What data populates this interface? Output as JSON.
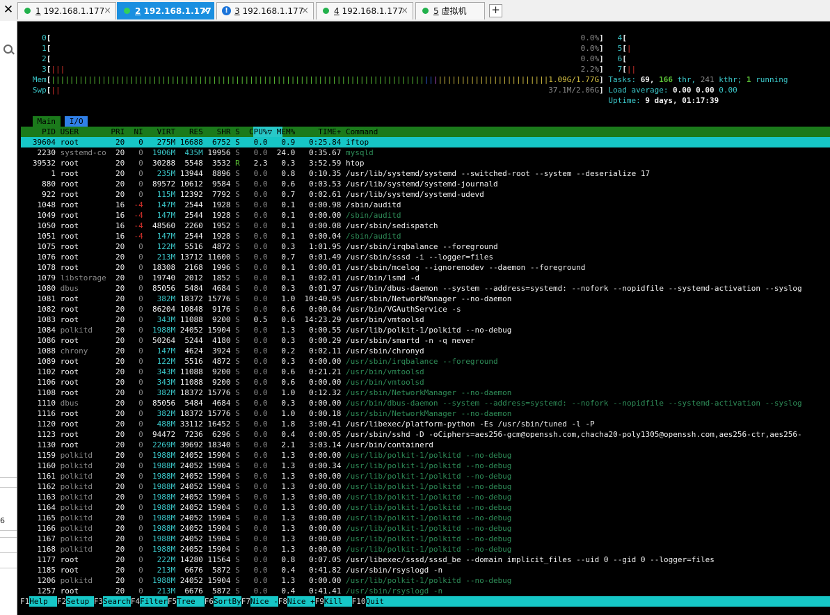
{
  "window": {
    "close_symbol": "✕",
    "tabs": [
      {
        "num": "1",
        "label": "192.168.1.177",
        "status": "connected",
        "active": false
      },
      {
        "num": "2",
        "label": "192.168.1.177",
        "status": "connected",
        "active": true
      },
      {
        "num": "3",
        "label": "192.168.1.177",
        "status": "warning",
        "active": false
      },
      {
        "num": "4",
        "label": "192.168.1.177",
        "status": "connected",
        "active": false
      },
      {
        "num": "5",
        "label": "虚拟机",
        "status": "connected",
        "active": false
      }
    ],
    "add_tab": "+",
    "left_digit": "6",
    "warn_symbol": "!",
    "tab_close": "×"
  },
  "meters": {
    "cpus": [
      {
        "id": "0",
        "bar": "",
        "pct": "0.0%"
      },
      {
        "id": "1",
        "bar": "",
        "pct": "0.0%"
      },
      {
        "id": "2",
        "bar": "",
        "pct": "0.0%"
      },
      {
        "id": "3",
        "bar": "|||",
        "pct": "2.2%"
      },
      {
        "id": "4",
        "bar": "",
        "pct": ""
      },
      {
        "id": "5",
        "bar": "|",
        "pct": ""
      },
      {
        "id": "6",
        "bar": "",
        "pct": ""
      },
      {
        "id": "7",
        "bar": "||",
        "pct": ""
      }
    ],
    "mem_label": "Mem",
    "mem_value": "1.09G/1.77G",
    "swp_label": "Swp",
    "swp_value": "37.1M/2.06G",
    "tasks_label": "Tasks:",
    "tasks": "69",
    "thr": "166",
    "thr_label": "thr,",
    "kthr": "241",
    "kthr_label": "kthr;",
    "running": "1",
    "running_label": "running",
    "load_label": "Load average:",
    "load1": "0.00",
    "load5": "0.00",
    "load15": "0.00",
    "uptime_label": "Uptime:",
    "uptime": "9 days, 01:17:39"
  },
  "screen_tabs": {
    "main": "Main",
    "io": "I/O"
  },
  "columns": {
    "pid": "PID",
    "user": "USER",
    "pri": "PRI",
    "ni": "NI",
    "virt": "VIRT",
    "res": "RES",
    "shr": "SHR",
    "s": "S",
    "cpu": "CPU%",
    "sort_indicator": "▽",
    "mem": "MEM%",
    "time": "TIME+",
    "command": "Command"
  },
  "processes": [
    {
      "pid": "39604",
      "user": "root",
      "pri": "20",
      "ni": "0",
      "virt": "275M",
      "res": "16688",
      "shr": "6752",
      "s": "S",
      "cpu": "0.0",
      "mem": "0.9",
      "time": "0:25.84",
      "cmd": "iftop",
      "thread": false,
      "selected": true
    },
    {
      "pid": "2230",
      "user": "systemd-co",
      "pri": "20",
      "ni": "0",
      "virt": "1906M",
      "res": "435M",
      "shr": "19956",
      "s": "S",
      "cpu": "0.0",
      "mem": "24.0",
      "time": "0:35.67",
      "cmd": "mysqld",
      "thread": true
    },
    {
      "pid": "39532",
      "user": "root",
      "pri": "20",
      "ni": "0",
      "virt": "30288",
      "res": "5548",
      "shr": "3532",
      "s": "R",
      "cpu": "2.3",
      "mem": "0.3",
      "time": "3:52.59",
      "cmd": "htop",
      "thread": false
    },
    {
      "pid": "1",
      "user": "root",
      "pri": "20",
      "ni": "0",
      "virt": "235M",
      "res": "13944",
      "shr": "8896",
      "s": "S",
      "cpu": "0.0",
      "mem": "0.8",
      "time": "0:10.35",
      "cmd": "/usr/lib/systemd/systemd --switched-root --system --deserialize 17",
      "thread": false
    },
    {
      "pid": "880",
      "user": "root",
      "pri": "20",
      "ni": "0",
      "virt": "89572",
      "res": "10612",
      "shr": "9584",
      "s": "S",
      "cpu": "0.0",
      "mem": "0.6",
      "time": "0:03.53",
      "cmd": "/usr/lib/systemd/systemd-journald",
      "thread": false
    },
    {
      "pid": "922",
      "user": "root",
      "pri": "20",
      "ni": "0",
      "virt": "115M",
      "res": "12392",
      "shr": "7792",
      "s": "S",
      "cpu": "0.0",
      "mem": "0.7",
      "time": "0:02.61",
      "cmd": "/usr/lib/systemd/systemd-udevd",
      "thread": false
    },
    {
      "pid": "1048",
      "user": "root",
      "pri": "16",
      "ni": "-4",
      "virt": "147M",
      "res": "2544",
      "shr": "1928",
      "s": "S",
      "cpu": "0.0",
      "mem": "0.1",
      "time": "0:00.98",
      "cmd": "/sbin/auditd",
      "thread": false
    },
    {
      "pid": "1049",
      "user": "root",
      "pri": "16",
      "ni": "-4",
      "virt": "147M",
      "res": "2544",
      "shr": "1928",
      "s": "S",
      "cpu": "0.0",
      "mem": "0.1",
      "time": "0:00.00",
      "cmd": "/sbin/auditd",
      "thread": true
    },
    {
      "pid": "1050",
      "user": "root",
      "pri": "16",
      "ni": "-4",
      "virt": "48560",
      "res": "2260",
      "shr": "1952",
      "s": "S",
      "cpu": "0.0",
      "mem": "0.1",
      "time": "0:00.08",
      "cmd": "/usr/sbin/sedispatch",
      "thread": false
    },
    {
      "pid": "1051",
      "user": "root",
      "pri": "16",
      "ni": "-4",
      "virt": "147M",
      "res": "2544",
      "shr": "1928",
      "s": "S",
      "cpu": "0.0",
      "mem": "0.1",
      "time": "0:00.04",
      "cmd": "/sbin/auditd",
      "thread": true
    },
    {
      "pid": "1075",
      "user": "root",
      "pri": "20",
      "ni": "0",
      "virt": "122M",
      "res": "5516",
      "shr": "4872",
      "s": "S",
      "cpu": "0.0",
      "mem": "0.3",
      "time": "1:01.95",
      "cmd": "/usr/sbin/irqbalance --foreground",
      "thread": false
    },
    {
      "pid": "1076",
      "user": "root",
      "pri": "20",
      "ni": "0",
      "virt": "213M",
      "res": "13712",
      "shr": "11600",
      "s": "S",
      "cpu": "0.0",
      "mem": "0.7",
      "time": "0:01.49",
      "cmd": "/usr/sbin/sssd -i --logger=files",
      "thread": false
    },
    {
      "pid": "1078",
      "user": "root",
      "pri": "20",
      "ni": "0",
      "virt": "18308",
      "res": "2168",
      "shr": "1996",
      "s": "S",
      "cpu": "0.0",
      "mem": "0.1",
      "time": "0:00.01",
      "cmd": "/usr/sbin/mcelog --ignorenodev --daemon --foreground",
      "thread": false
    },
    {
      "pid": "1079",
      "user": "libstorage",
      "pri": "20",
      "ni": "0",
      "virt": "19740",
      "res": "2012",
      "shr": "1852",
      "s": "S",
      "cpu": "0.0",
      "mem": "0.1",
      "time": "0:02.01",
      "cmd": "/usr/bin/lsmd -d",
      "thread": false
    },
    {
      "pid": "1080",
      "user": "dbus",
      "pri": "20",
      "ni": "0",
      "virt": "85056",
      "res": "5484",
      "shr": "4684",
      "s": "S",
      "cpu": "0.0",
      "mem": "0.3",
      "time": "0:01.97",
      "cmd": "/usr/bin/dbus-daemon --system --address=systemd: --nofork --nopidfile --systemd-activation --syslog",
      "thread": false
    },
    {
      "pid": "1081",
      "user": "root",
      "pri": "20",
      "ni": "0",
      "virt": "382M",
      "res": "18372",
      "shr": "15776",
      "s": "S",
      "cpu": "0.0",
      "mem": "1.0",
      "time": "10:40.95",
      "cmd": "/usr/sbin/NetworkManager --no-daemon",
      "thread": false
    },
    {
      "pid": "1082",
      "user": "root",
      "pri": "20",
      "ni": "0",
      "virt": "86204",
      "res": "10848",
      "shr": "9176",
      "s": "S",
      "cpu": "0.0",
      "mem": "0.6",
      "time": "0:00.04",
      "cmd": "/usr/bin/VGAuthService -s",
      "thread": false
    },
    {
      "pid": "1083",
      "user": "root",
      "pri": "20",
      "ni": "0",
      "virt": "343M",
      "res": "11088",
      "shr": "9200",
      "s": "S",
      "cpu": "0.5",
      "mem": "0.6",
      "time": "14:23.29",
      "cmd": "/usr/bin/vmtoolsd",
      "thread": false
    },
    {
      "pid": "1084",
      "user": "polkitd",
      "pri": "20",
      "ni": "0",
      "virt": "1988M",
      "res": "24052",
      "shr": "15904",
      "s": "S",
      "cpu": "0.0",
      "mem": "1.3",
      "time": "0:00.55",
      "cmd": "/usr/lib/polkit-1/polkitd --no-debug",
      "thread": false
    },
    {
      "pid": "1086",
      "user": "root",
      "pri": "20",
      "ni": "0",
      "virt": "50264",
      "res": "5244",
      "shr": "4180",
      "s": "S",
      "cpu": "0.0",
      "mem": "0.3",
      "time": "0:00.29",
      "cmd": "/usr/sbin/smartd -n -q never",
      "thread": false
    },
    {
      "pid": "1088",
      "user": "chrony",
      "pri": "20",
      "ni": "0",
      "virt": "147M",
      "res": "4624",
      "shr": "3924",
      "s": "S",
      "cpu": "0.0",
      "mem": "0.2",
      "time": "0:02.11",
      "cmd": "/usr/sbin/chronyd",
      "thread": false
    },
    {
      "pid": "1089",
      "user": "root",
      "pri": "20",
      "ni": "0",
      "virt": "122M",
      "res": "5516",
      "shr": "4872",
      "s": "S",
      "cpu": "0.0",
      "mem": "0.3",
      "time": "0:00.00",
      "cmd": "/usr/sbin/irqbalance --foreground",
      "thread": true
    },
    {
      "pid": "1102",
      "user": "root",
      "pri": "20",
      "ni": "0",
      "virt": "343M",
      "res": "11088",
      "shr": "9200",
      "s": "S",
      "cpu": "0.0",
      "mem": "0.6",
      "time": "0:21.21",
      "cmd": "/usr/bin/vmtoolsd",
      "thread": true
    },
    {
      "pid": "1106",
      "user": "root",
      "pri": "20",
      "ni": "0",
      "virt": "343M",
      "res": "11088",
      "shr": "9200",
      "s": "S",
      "cpu": "0.0",
      "mem": "0.6",
      "time": "0:00.00",
      "cmd": "/usr/bin/vmtoolsd",
      "thread": true
    },
    {
      "pid": "1108",
      "user": "root",
      "pri": "20",
      "ni": "0",
      "virt": "382M",
      "res": "18372",
      "shr": "15776",
      "s": "S",
      "cpu": "0.0",
      "mem": "1.0",
      "time": "0:12.32",
      "cmd": "/usr/sbin/NetworkManager --no-daemon",
      "thread": true
    },
    {
      "pid": "1110",
      "user": "dbus",
      "pri": "20",
      "ni": "0",
      "virt": "85056",
      "res": "5484",
      "shr": "4684",
      "s": "S",
      "cpu": "0.0",
      "mem": "0.3",
      "time": "0:00.00",
      "cmd": "/usr/bin/dbus-daemon --system --address=systemd: --nofork --nopidfile --systemd-activation --syslog",
      "thread": true
    },
    {
      "pid": "1116",
      "user": "root",
      "pri": "20",
      "ni": "0",
      "virt": "382M",
      "res": "18372",
      "shr": "15776",
      "s": "S",
      "cpu": "0.0",
      "mem": "1.0",
      "time": "0:00.18",
      "cmd": "/usr/sbin/NetworkManager --no-daemon",
      "thread": true
    },
    {
      "pid": "1120",
      "user": "root",
      "pri": "20",
      "ni": "0",
      "virt": "488M",
      "res": "33112",
      "shr": "16452",
      "s": "S",
      "cpu": "0.0",
      "mem": "1.8",
      "time": "3:00.41",
      "cmd": "/usr/libexec/platform-python -Es /usr/sbin/tuned -l -P",
      "thread": false
    },
    {
      "pid": "1123",
      "user": "root",
      "pri": "20",
      "ni": "0",
      "virt": "94472",
      "res": "7236",
      "shr": "6296",
      "s": "S",
      "cpu": "0.0",
      "mem": "0.4",
      "time": "0:00.05",
      "cmd": "/usr/sbin/sshd -D -oCiphers=aes256-gcm@openssh.com,chacha20-poly1305@openssh.com,aes256-ctr,aes256-",
      "thread": false
    },
    {
      "pid": "1130",
      "user": "root",
      "pri": "20",
      "ni": "0",
      "virt": "2269M",
      "res": "39692",
      "shr": "18340",
      "s": "S",
      "cpu": "0.0",
      "mem": "2.1",
      "time": "3:03.14",
      "cmd": "/usr/bin/containerd",
      "thread": false
    },
    {
      "pid": "1159",
      "user": "polkitd",
      "pri": "20",
      "ni": "0",
      "virt": "1988M",
      "res": "24052",
      "shr": "15904",
      "s": "S",
      "cpu": "0.0",
      "mem": "1.3",
      "time": "0:00.00",
      "cmd": "/usr/lib/polkit-1/polkitd --no-debug",
      "thread": true
    },
    {
      "pid": "1160",
      "user": "polkitd",
      "pri": "20",
      "ni": "0",
      "virt": "1988M",
      "res": "24052",
      "shr": "15904",
      "s": "S",
      "cpu": "0.0",
      "mem": "1.3",
      "time": "0:00.34",
      "cmd": "/usr/lib/polkit-1/polkitd --no-debug",
      "thread": true
    },
    {
      "pid": "1161",
      "user": "polkitd",
      "pri": "20",
      "ni": "0",
      "virt": "1988M",
      "res": "24052",
      "shr": "15904",
      "s": "S",
      "cpu": "0.0",
      "mem": "1.3",
      "time": "0:00.00",
      "cmd": "/usr/lib/polkit-1/polkitd --no-debug",
      "thread": true
    },
    {
      "pid": "1162",
      "user": "polkitd",
      "pri": "20",
      "ni": "0",
      "virt": "1988M",
      "res": "24052",
      "shr": "15904",
      "s": "S",
      "cpu": "0.0",
      "mem": "1.3",
      "time": "0:00.00",
      "cmd": "/usr/lib/polkit-1/polkitd --no-debug",
      "thread": true
    },
    {
      "pid": "1163",
      "user": "polkitd",
      "pri": "20",
      "ni": "0",
      "virt": "1988M",
      "res": "24052",
      "shr": "15904",
      "s": "S",
      "cpu": "0.0",
      "mem": "1.3",
      "time": "0:00.00",
      "cmd": "/usr/lib/polkit-1/polkitd --no-debug",
      "thread": true
    },
    {
      "pid": "1164",
      "user": "polkitd",
      "pri": "20",
      "ni": "0",
      "virt": "1988M",
      "res": "24052",
      "shr": "15904",
      "s": "S",
      "cpu": "0.0",
      "mem": "1.3",
      "time": "0:00.00",
      "cmd": "/usr/lib/polkit-1/polkitd --no-debug",
      "thread": true
    },
    {
      "pid": "1165",
      "user": "polkitd",
      "pri": "20",
      "ni": "0",
      "virt": "1988M",
      "res": "24052",
      "shr": "15904",
      "s": "S",
      "cpu": "0.0",
      "mem": "1.3",
      "time": "0:00.00",
      "cmd": "/usr/lib/polkit-1/polkitd --no-debug",
      "thread": true
    },
    {
      "pid": "1166",
      "user": "polkitd",
      "pri": "20",
      "ni": "0",
      "virt": "1988M",
      "res": "24052",
      "shr": "15904",
      "s": "S",
      "cpu": "0.0",
      "mem": "1.3",
      "time": "0:00.00",
      "cmd": "/usr/lib/polkit-1/polkitd --no-debug",
      "thread": true
    },
    {
      "pid": "1167",
      "user": "polkitd",
      "pri": "20",
      "ni": "0",
      "virt": "1988M",
      "res": "24052",
      "shr": "15904",
      "s": "S",
      "cpu": "0.0",
      "mem": "1.3",
      "time": "0:00.00",
      "cmd": "/usr/lib/polkit-1/polkitd --no-debug",
      "thread": true
    },
    {
      "pid": "1168",
      "user": "polkitd",
      "pri": "20",
      "ni": "0",
      "virt": "1988M",
      "res": "24052",
      "shr": "15904",
      "s": "S",
      "cpu": "0.0",
      "mem": "1.3",
      "time": "0:00.00",
      "cmd": "/usr/lib/polkit-1/polkitd --no-debug",
      "thread": true
    },
    {
      "pid": "1177",
      "user": "root",
      "pri": "20",
      "ni": "0",
      "virt": "222M",
      "res": "14280",
      "shr": "11564",
      "s": "S",
      "cpu": "0.0",
      "mem": "0.8",
      "time": "0:07.05",
      "cmd": "/usr/libexec/sssd/sssd_be --domain implicit_files --uid 0 --gid 0 --logger=files",
      "thread": false
    },
    {
      "pid": "1185",
      "user": "root",
      "pri": "20",
      "ni": "0",
      "virt": "213M",
      "res": "6676",
      "shr": "5872",
      "s": "S",
      "cpu": "0.0",
      "mem": "0.4",
      "time": "0:41.82",
      "cmd": "/usr/sbin/rsyslogd -n",
      "thread": false
    },
    {
      "pid": "1206",
      "user": "polkitd",
      "pri": "20",
      "ni": "0",
      "virt": "1988M",
      "res": "24052",
      "shr": "15904",
      "s": "S",
      "cpu": "0.0",
      "mem": "1.3",
      "time": "0:00.00",
      "cmd": "/usr/lib/polkit-1/polkitd --no-debug",
      "thread": true
    },
    {
      "pid": "1257",
      "user": "root",
      "pri": "20",
      "ni": "0",
      "virt": "213M",
      "res": "6676",
      "shr": "5872",
      "s": "S",
      "cpu": "0.0",
      "mem": "0.4",
      "time": "0:41.41",
      "cmd": "/usr/sbin/rsyslogd -n",
      "thread": true
    }
  ],
  "function_keys": [
    {
      "key": "F1",
      "label": "Help"
    },
    {
      "key": "F2",
      "label": "Setup"
    },
    {
      "key": "F3",
      "label": "Search"
    },
    {
      "key": "F4",
      "label": "Filter"
    },
    {
      "key": "F5",
      "label": "Tree"
    },
    {
      "key": "F6",
      "label": "SortBy"
    },
    {
      "key": "F7",
      "label": "Nice -"
    },
    {
      "key": "F8",
      "label": "Nice +"
    },
    {
      "key": "F9",
      "label": "Kill"
    },
    {
      "key": "F10",
      "label": "Quit"
    }
  ],
  "colors": {
    "selection": "#16c6c6",
    "header": "#1b7a1b",
    "thread": "#2e8b57",
    "accent_tab": "#1a8fe0"
  }
}
